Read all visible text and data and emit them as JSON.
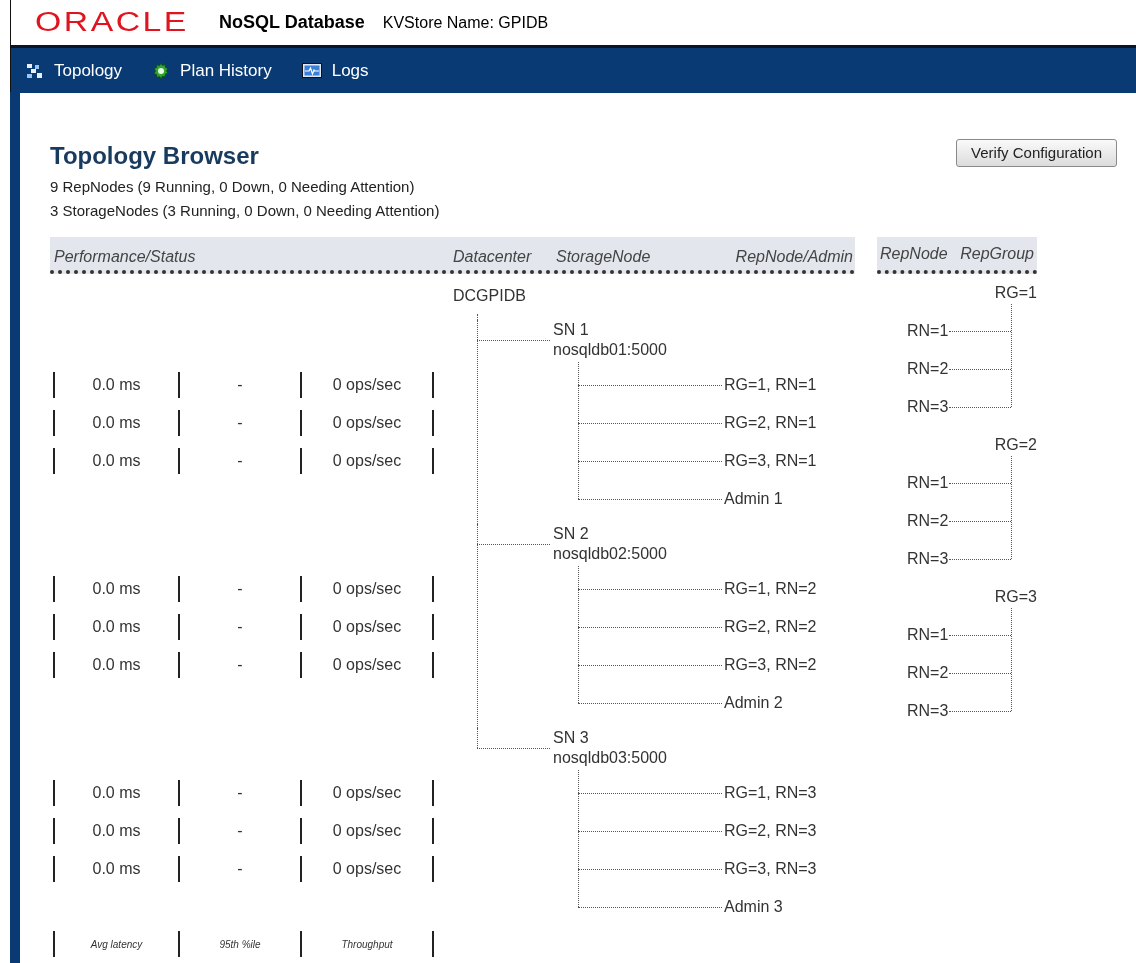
{
  "header": {
    "logo": "ORACLE",
    "product": "NoSQL Database",
    "store_label": "KVStore Name: GPIDB"
  },
  "nav": [
    {
      "label": "Topology",
      "kind": "topology"
    },
    {
      "label": "Plan History",
      "kind": "plans"
    },
    {
      "label": "Logs",
      "kind": "logs"
    }
  ],
  "page": {
    "title": "Topology Browser",
    "summary": [
      "9 RepNodes (9 Running, 0 Down, 0 Needing Attention)",
      "3 StorageNodes (3 Running, 0 Down, 0 Needing Attention)"
    ],
    "verify_button": "Verify Configuration"
  },
  "columns": [
    "Performance/Status",
    "Datacenter",
    "StorageNode",
    "RepNode/Admin"
  ],
  "group_columns": [
    "RepNode",
    "RepGroup"
  ],
  "datacenter": "DCGPIDB",
  "storage_nodes": [
    {
      "name": "SN 1",
      "host": "nosqldb01:5000",
      "children": [
        {
          "kind": "repnode",
          "label": "RG=1, RN=1",
          "latency": "0.0 ms",
          "percentile": "-",
          "throughput": "0 ops/sec"
        },
        {
          "kind": "repnode",
          "label": "RG=2, RN=1",
          "latency": "0.0 ms",
          "percentile": "-",
          "throughput": "0 ops/sec"
        },
        {
          "kind": "repnode",
          "label": "RG=3, RN=1",
          "latency": "0.0 ms",
          "percentile": "-",
          "throughput": "0 ops/sec"
        },
        {
          "kind": "admin",
          "label": "Admin 1"
        }
      ]
    },
    {
      "name": "SN 2",
      "host": "nosqldb02:5000",
      "children": [
        {
          "kind": "repnode",
          "label": "RG=1, RN=2",
          "latency": "0.0 ms",
          "percentile": "-",
          "throughput": "0 ops/sec"
        },
        {
          "kind": "repnode",
          "label": "RG=2, RN=2",
          "latency": "0.0 ms",
          "percentile": "-",
          "throughput": "0 ops/sec"
        },
        {
          "kind": "repnode",
          "label": "RG=3, RN=2",
          "latency": "0.0 ms",
          "percentile": "-",
          "throughput": "0 ops/sec"
        },
        {
          "kind": "admin",
          "label": "Admin 2"
        }
      ]
    },
    {
      "name": "SN 3",
      "host": "nosqldb03:5000",
      "children": [
        {
          "kind": "repnode",
          "label": "RG=1, RN=3",
          "latency": "0.0 ms",
          "percentile": "-",
          "throughput": "0 ops/sec"
        },
        {
          "kind": "repnode",
          "label": "RG=2, RN=3",
          "latency": "0.0 ms",
          "percentile": "-",
          "throughput": "0 ops/sec"
        },
        {
          "kind": "repnode",
          "label": "RG=3, RN=3",
          "latency": "0.0 ms",
          "percentile": "-",
          "throughput": "0 ops/sec"
        },
        {
          "kind": "admin",
          "label": "Admin 3"
        }
      ]
    }
  ],
  "rep_groups": [
    {
      "label": "RG=1",
      "children": [
        {
          "label": "RN=1"
        },
        {
          "label": "RN=2"
        },
        {
          "label": "RN=3"
        }
      ]
    },
    {
      "label": "RG=2",
      "children": [
        {
          "label": "RN=1"
        },
        {
          "label": "RN=2"
        },
        {
          "label": "RN=3"
        }
      ]
    },
    {
      "label": "RG=3",
      "children": [
        {
          "label": "RN=1"
        },
        {
          "label": "RN=2"
        },
        {
          "label": "RN=3"
        }
      ]
    }
  ],
  "legend": [
    "Avg latency",
    "95th %ile",
    "Throughput"
  ]
}
